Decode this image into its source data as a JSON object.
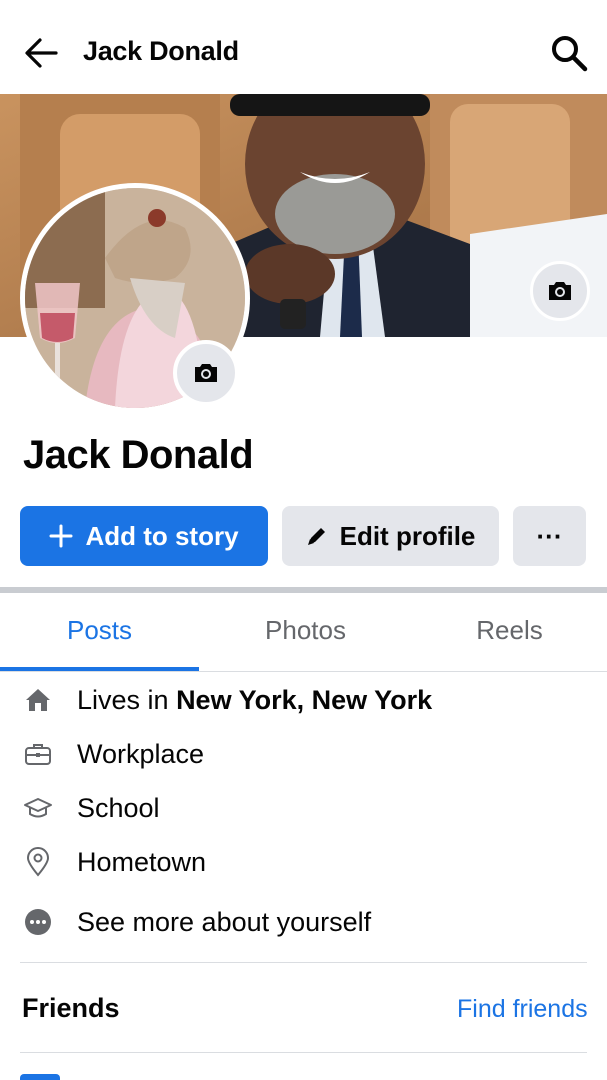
{
  "header": {
    "title": "Jack Donald",
    "back_icon": "arrow-left-icon",
    "search_icon": "search-icon"
  },
  "profile": {
    "name": "Jack Donald"
  },
  "actions": {
    "add_story_label": "Add to story",
    "edit_profile_label": "Edit profile",
    "more_label": "···"
  },
  "tabs": [
    {
      "label": "Posts",
      "active": true
    },
    {
      "label": "Photos",
      "active": false
    },
    {
      "label": "Reels",
      "active": false
    }
  ],
  "details": {
    "lives_prefix": "Lives in ",
    "lives_location": "New York, New York",
    "workplace": "Workplace",
    "school": "School",
    "hometown": "Hometown",
    "see_more": "See more about yourself"
  },
  "friends": {
    "title": "Friends",
    "find_label": "Find friends"
  },
  "colors": {
    "accent": "#1b74e4",
    "button_gray": "#e4e6eb",
    "text_secondary": "#65676b"
  }
}
